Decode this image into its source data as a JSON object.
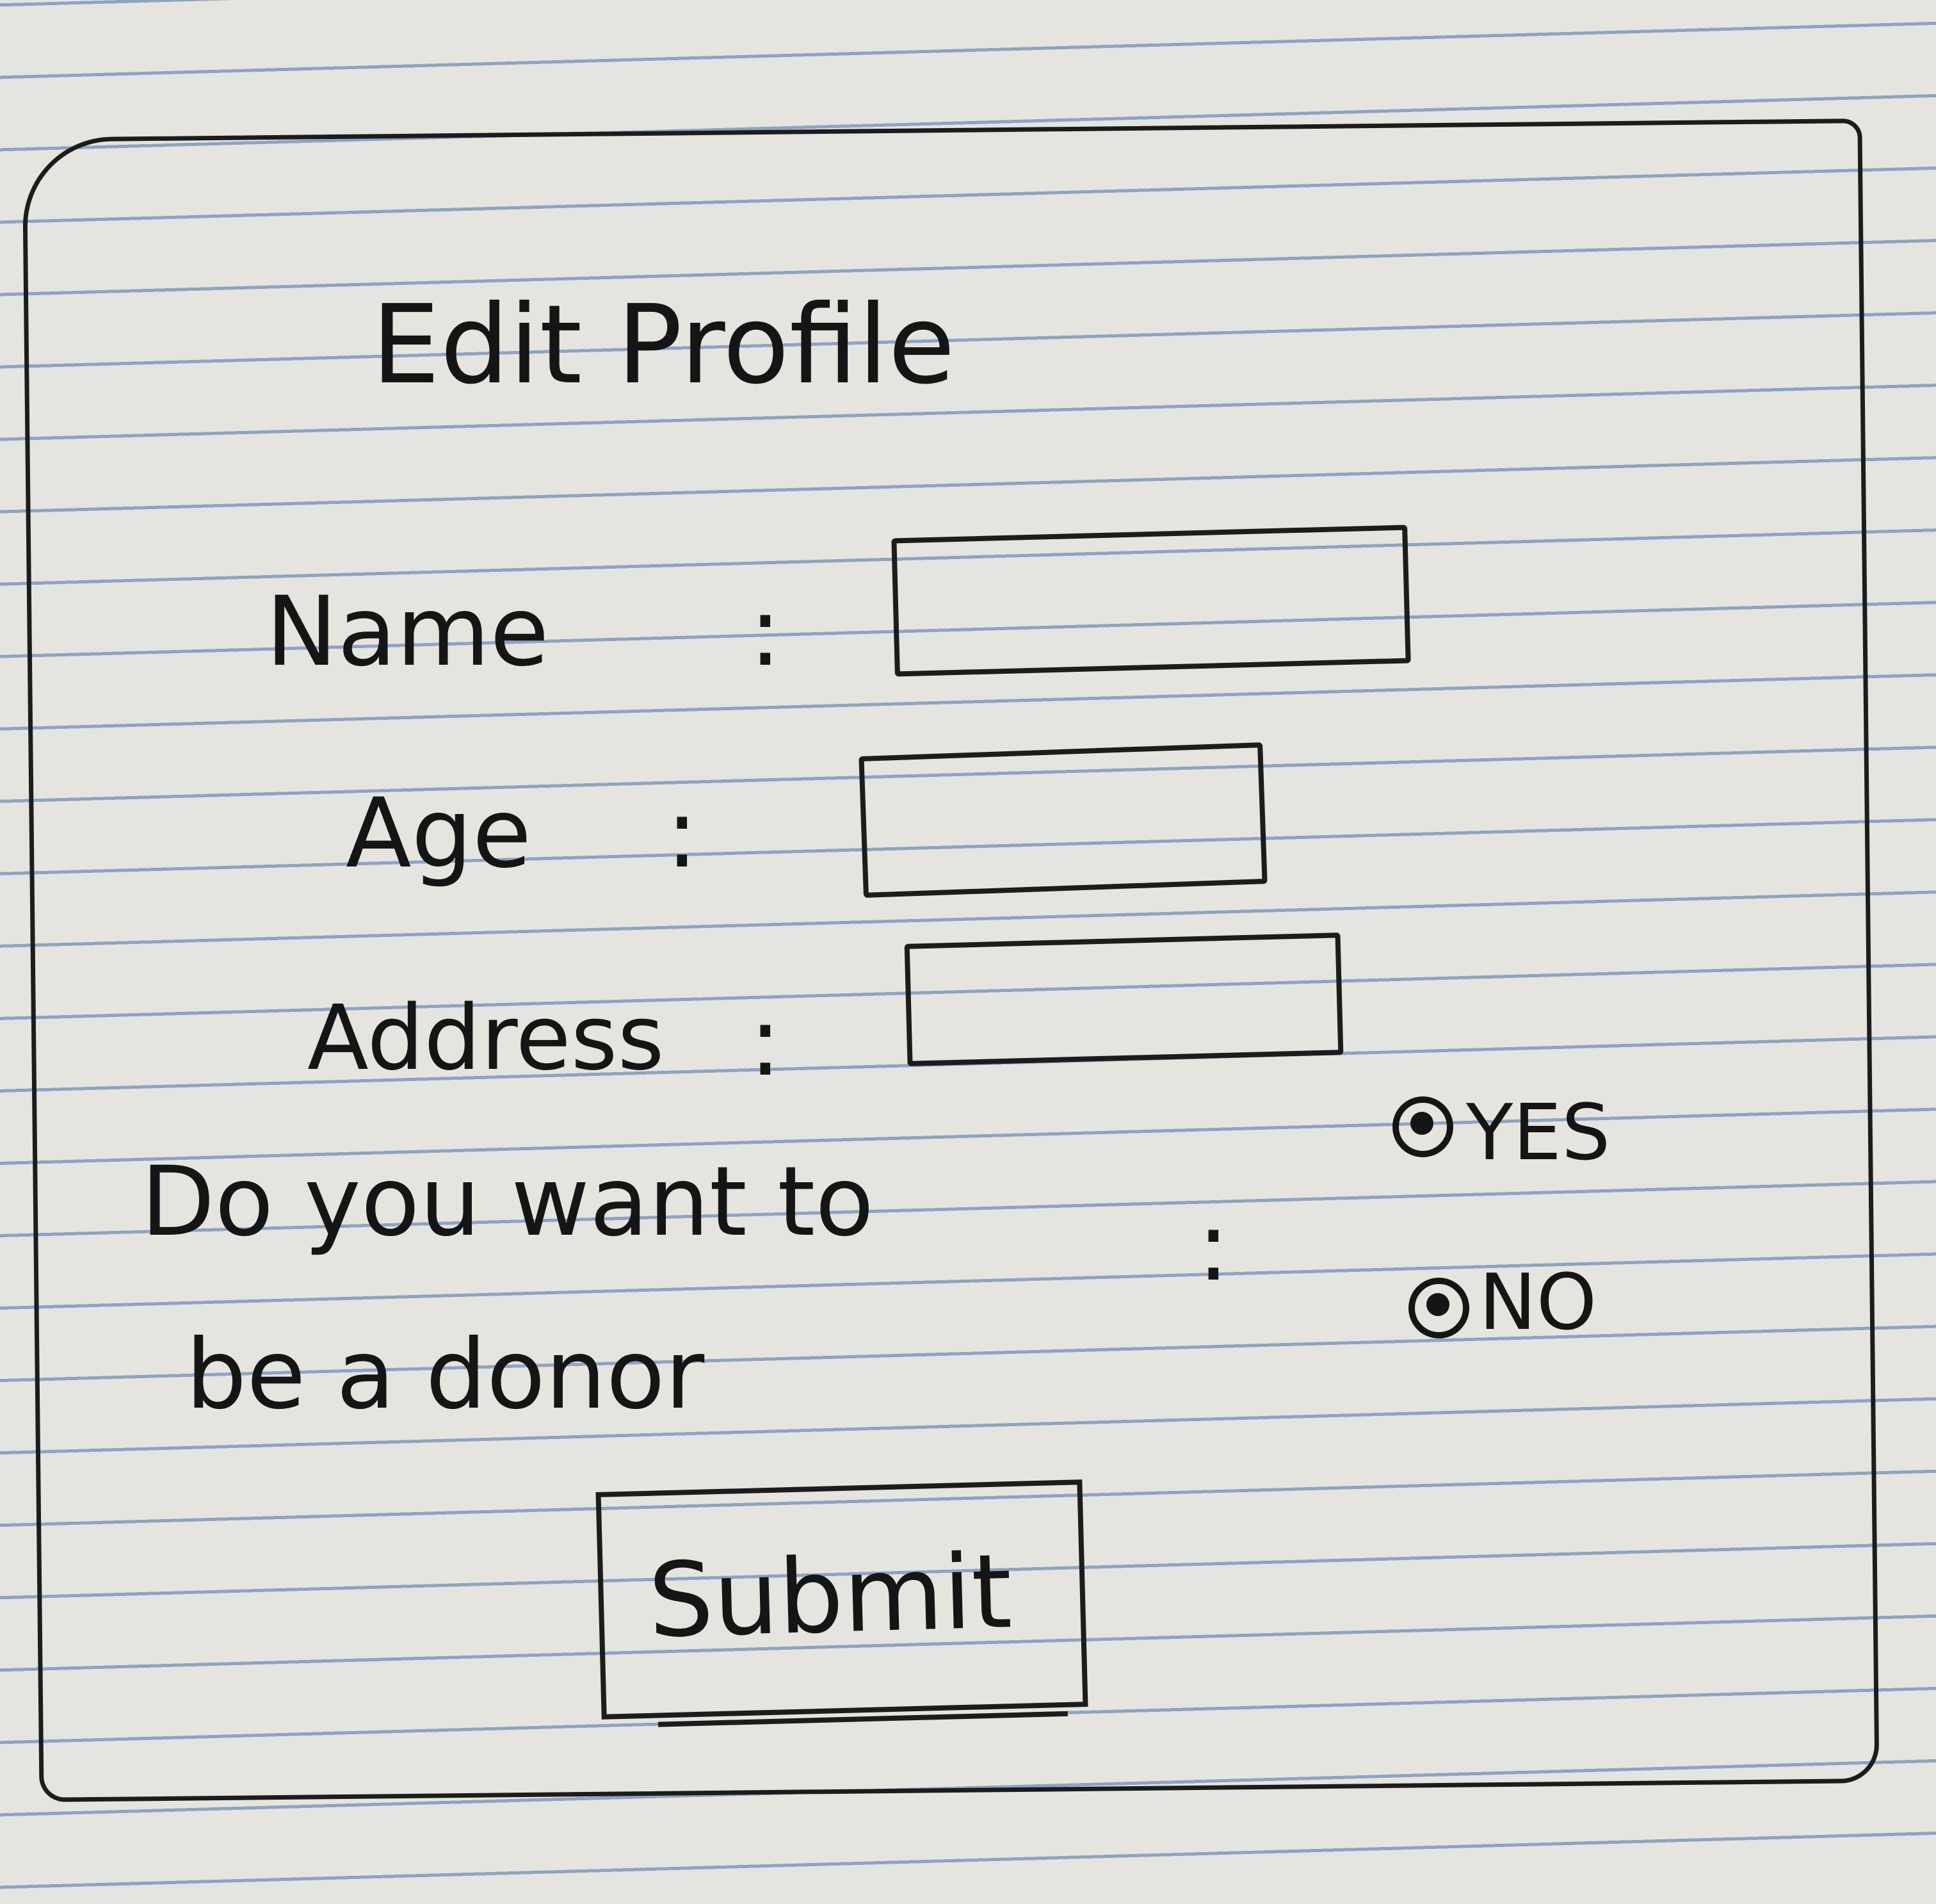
{
  "form": {
    "title": "Edit Profile",
    "fields": [
      {
        "label": "Name",
        "separator": ":",
        "value": ""
      },
      {
        "label": "Age",
        "separator": ":",
        "value": ""
      },
      {
        "label": "Address",
        "separator": ":",
        "value": ""
      }
    ],
    "donor_question": {
      "line1": "Do you want to",
      "line2": "be a donor",
      "separator": ":",
      "options": [
        {
          "label": "YES"
        },
        {
          "label": "NO"
        }
      ]
    },
    "submit_label": "Submit"
  }
}
